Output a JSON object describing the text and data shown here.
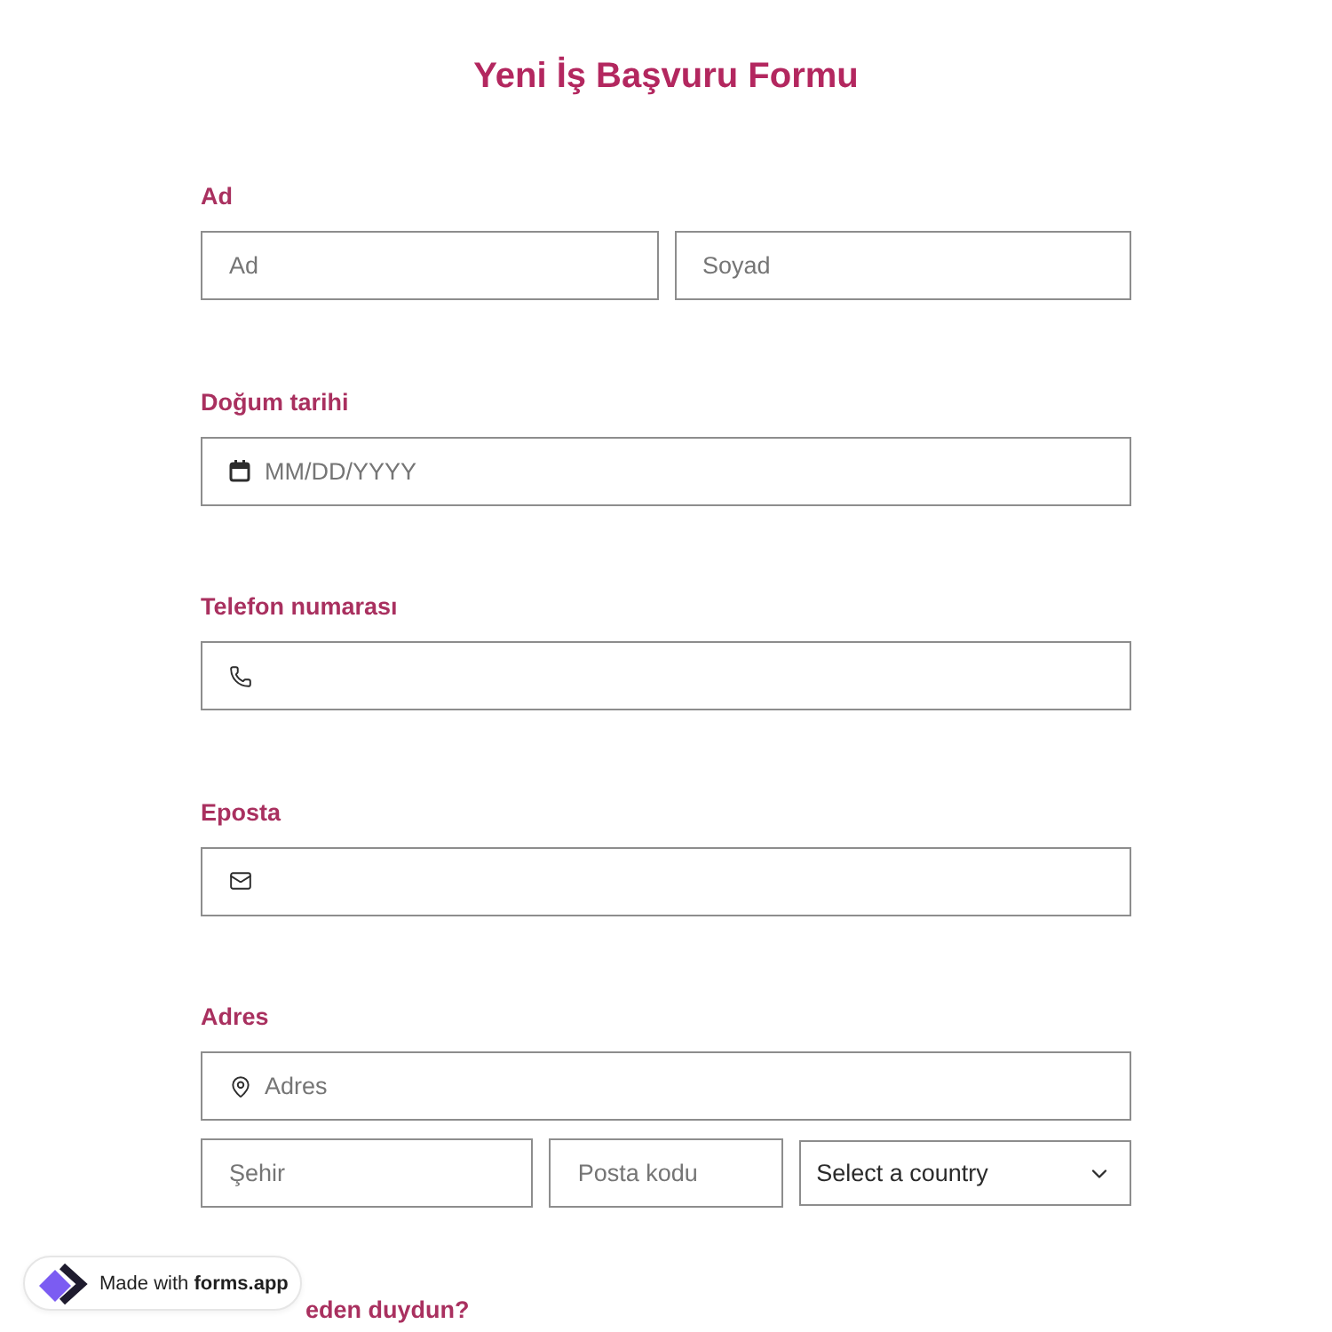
{
  "title": "Yeni İş Başvuru Formu",
  "fields": [
    {
      "label": "Ad",
      "rows": [
        [
          {
            "kind": "text",
            "placeholder": "Ad"
          },
          {
            "kind": "text",
            "placeholder": "Soyad"
          }
        ]
      ]
    },
    {
      "label": "Doğum tarihi",
      "rows": [
        [
          {
            "kind": "date",
            "placeholder": "MM/DD/YYYY"
          }
        ]
      ]
    },
    {
      "label": "Telefon numarası",
      "rows": [
        [
          {
            "kind": "phone"
          }
        ]
      ]
    },
    {
      "label": "Eposta",
      "rows": [
        [
          {
            "kind": "email"
          }
        ]
      ]
    },
    {
      "label": "Adres",
      "rows": [
        [
          {
            "kind": "address",
            "placeholder": "Adres"
          }
        ],
        [
          {
            "kind": "text",
            "placeholder": "Şehir"
          },
          {
            "kind": "text",
            "placeholder": "Posta kodu"
          },
          {
            "kind": "select",
            "value": "Select a country"
          }
        ]
      ]
    },
    {
      "label": "eden duydun?"
    }
  ],
  "badge": {
    "text": "Made with **forms.app**"
  }
}
